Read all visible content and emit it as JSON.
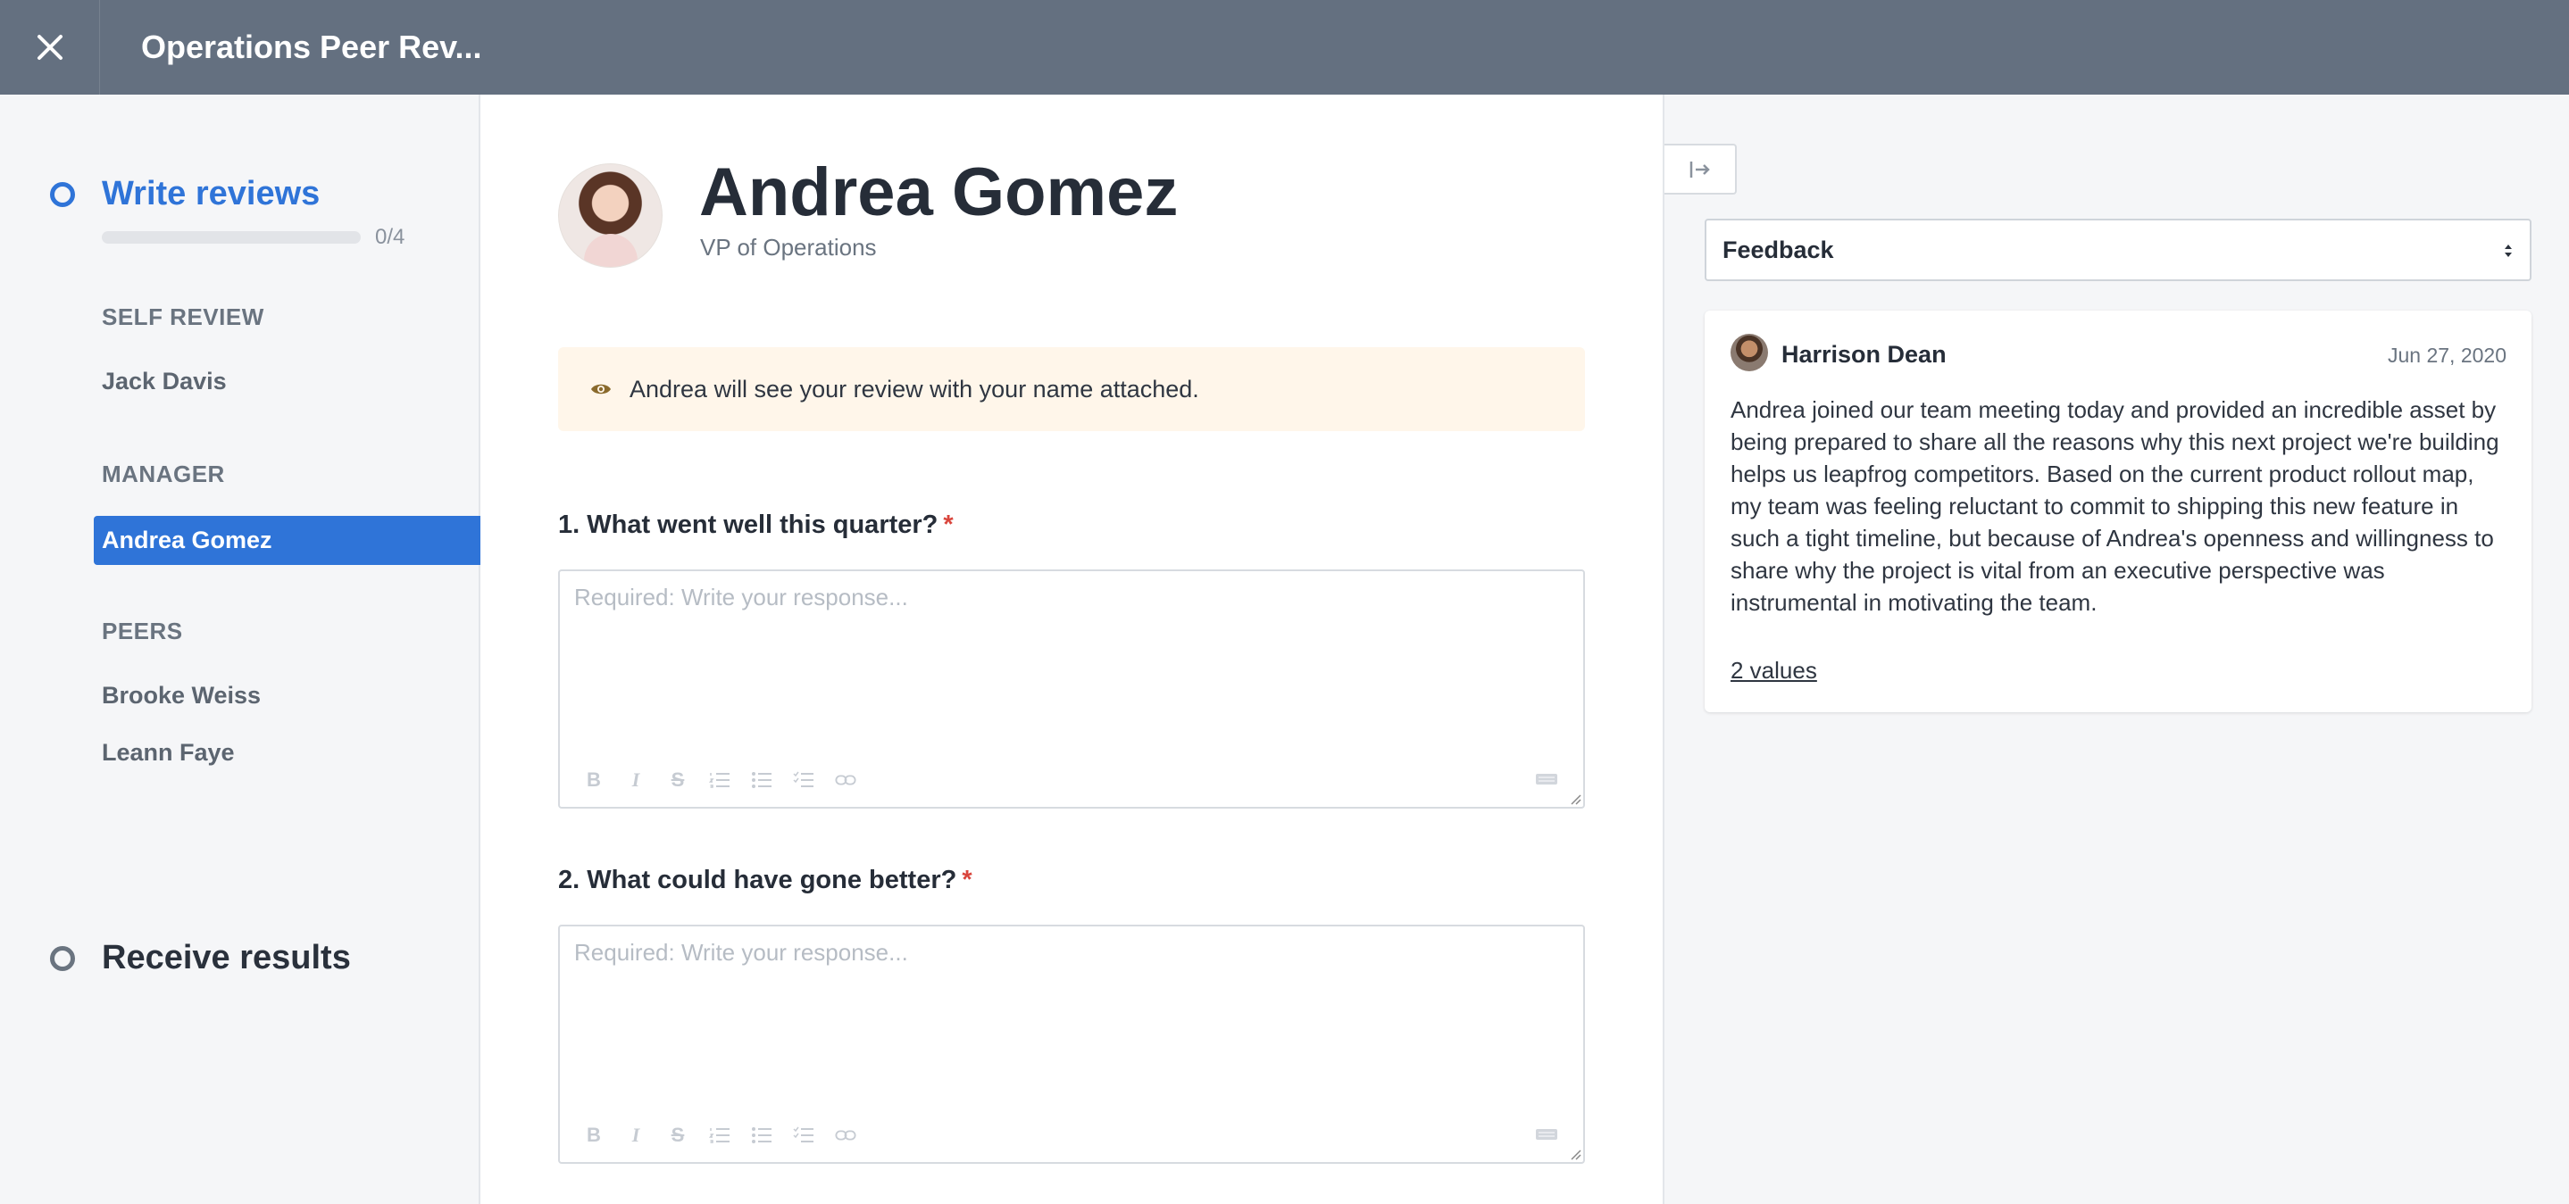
{
  "header": {
    "title": "Operations Peer Rev..."
  },
  "sidebar": {
    "steps": [
      {
        "label": "Write reviews",
        "progress_text": "0/4",
        "progress": 0
      },
      {
        "label": "Receive results"
      }
    ],
    "sections": [
      {
        "heading": "SELF REVIEW",
        "items": [
          "Jack Davis"
        ]
      },
      {
        "heading": "MANAGER",
        "items": [
          "Andrea Gomez"
        ]
      },
      {
        "heading": "PEERS",
        "items": [
          "Brooke Weiss",
          "Leann Faye"
        ]
      }
    ],
    "active_item": "Andrea Gomez"
  },
  "main": {
    "person": {
      "name": "Andrea Gomez",
      "role": "VP of Operations"
    },
    "notice": "Andrea will see your review with your name attached.",
    "questions": [
      {
        "label": "1. What went well this quarter?",
        "required_mark": "*",
        "placeholder": "Required: Write your response..."
      },
      {
        "label": "2. What could have gone better?",
        "required_mark": "*",
        "placeholder": "Required: Write your response..."
      }
    ]
  },
  "panel": {
    "select_value": "Feedback",
    "feedback": {
      "author": "Harrison Dean",
      "date": "Jun 27, 2020",
      "text": "Andrea joined our team meeting today and provided an incredible asset by being prepared to share all the reasons why this next project we're building helps us leapfrog competitors. Based on the current product rollout map, my team was feeling reluctant to commit to shipping this new feature in such a tight timeline, but because of Andrea's openness and willingness to share why the project is vital from an executive perspective was instrumental in motivating the team.",
      "values_link": "2 values"
    }
  },
  "colors": {
    "accent": "#2f74d8",
    "topbar": "#647080",
    "required": "#d9453c",
    "notice_bg": "#fff6ea"
  }
}
